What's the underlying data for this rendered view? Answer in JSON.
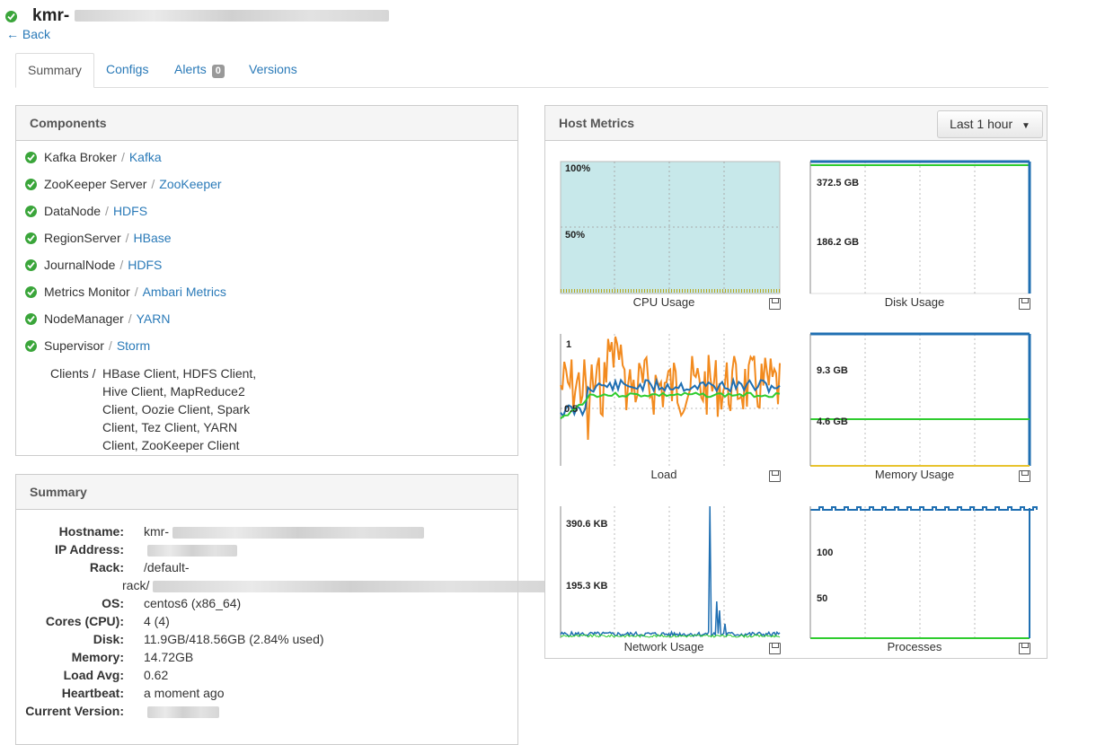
{
  "header": {
    "title_prefix": "kmr-",
    "back_label": "Back"
  },
  "tabs": [
    {
      "label": "Summary"
    },
    {
      "label": "Configs"
    },
    {
      "label": "Alerts",
      "badge": "0"
    },
    {
      "label": "Versions"
    }
  ],
  "components": {
    "title": "Components",
    "items": [
      {
        "name": "Kafka Broker",
        "service": "Kafka"
      },
      {
        "name": "ZooKeeper Server",
        "service": "ZooKeeper"
      },
      {
        "name": "DataNode",
        "service": "HDFS"
      },
      {
        "name": "RegionServer",
        "service": "HBase"
      },
      {
        "name": "JournalNode",
        "service": "HDFS"
      },
      {
        "name": "Metrics Monitor",
        "service": "Ambari Metrics"
      },
      {
        "name": "NodeManager",
        "service": "YARN"
      },
      {
        "name": "Supervisor",
        "service": "Storm"
      }
    ],
    "clients_label": "Clients /",
    "clients_lines": [
      "HBase Client, HDFS Client,",
      "Hive Client, MapReduce2",
      "Client, Oozie Client, Spark",
      "Client, Tez Client, YARN",
      "Client, ZooKeeper Client"
    ]
  },
  "summary": {
    "title": "Summary",
    "rows": [
      {
        "label": "Hostname:",
        "value": "kmr-"
      },
      {
        "label": "IP Address:",
        "value": ""
      },
      {
        "label": "Rack:",
        "value": "/default-"
      },
      {
        "label": "",
        "value": "rack/"
      },
      {
        "label": "OS:",
        "value": "centos6 (x86_64)"
      },
      {
        "label": "Cores (CPU):",
        "value": "4 (4)"
      },
      {
        "label": "Disk:",
        "value": "11.9GB/418.56GB (2.84% used)"
      },
      {
        "label": "Memory:",
        "value": "14.72GB"
      },
      {
        "label": "Load Avg:",
        "value": "0.62"
      },
      {
        "label": "Heartbeat:",
        "value": "a moment ago"
      },
      {
        "label": "Current Version:",
        "value": ""
      }
    ]
  },
  "metrics": {
    "title": "Host Metrics",
    "range": "Last 1 hour",
    "charts": [
      {
        "name": "CPU Usage",
        "ticks": [
          "100%",
          "50%"
        ]
      },
      {
        "name": "Disk Usage",
        "ticks": [
          "372.5 GB",
          "186.2 GB"
        ]
      },
      {
        "name": "Load",
        "ticks": [
          "1",
          "0.5"
        ]
      },
      {
        "name": "Memory Usage",
        "ticks": [
          "9.3 GB",
          "4.6 GB"
        ]
      },
      {
        "name": "Network Usage",
        "ticks": [
          "390.6 KB",
          "195.3 KB"
        ]
      },
      {
        "name": "Processes",
        "ticks": [
          "100",
          "50"
        ]
      }
    ]
  },
  "colors": {
    "link": "#2a7ab8",
    "ok": "#3aa53a",
    "series_blue": "#1f6fb2",
    "series_green": "#2ecc2e",
    "series_orange": "#f28a1e"
  }
}
